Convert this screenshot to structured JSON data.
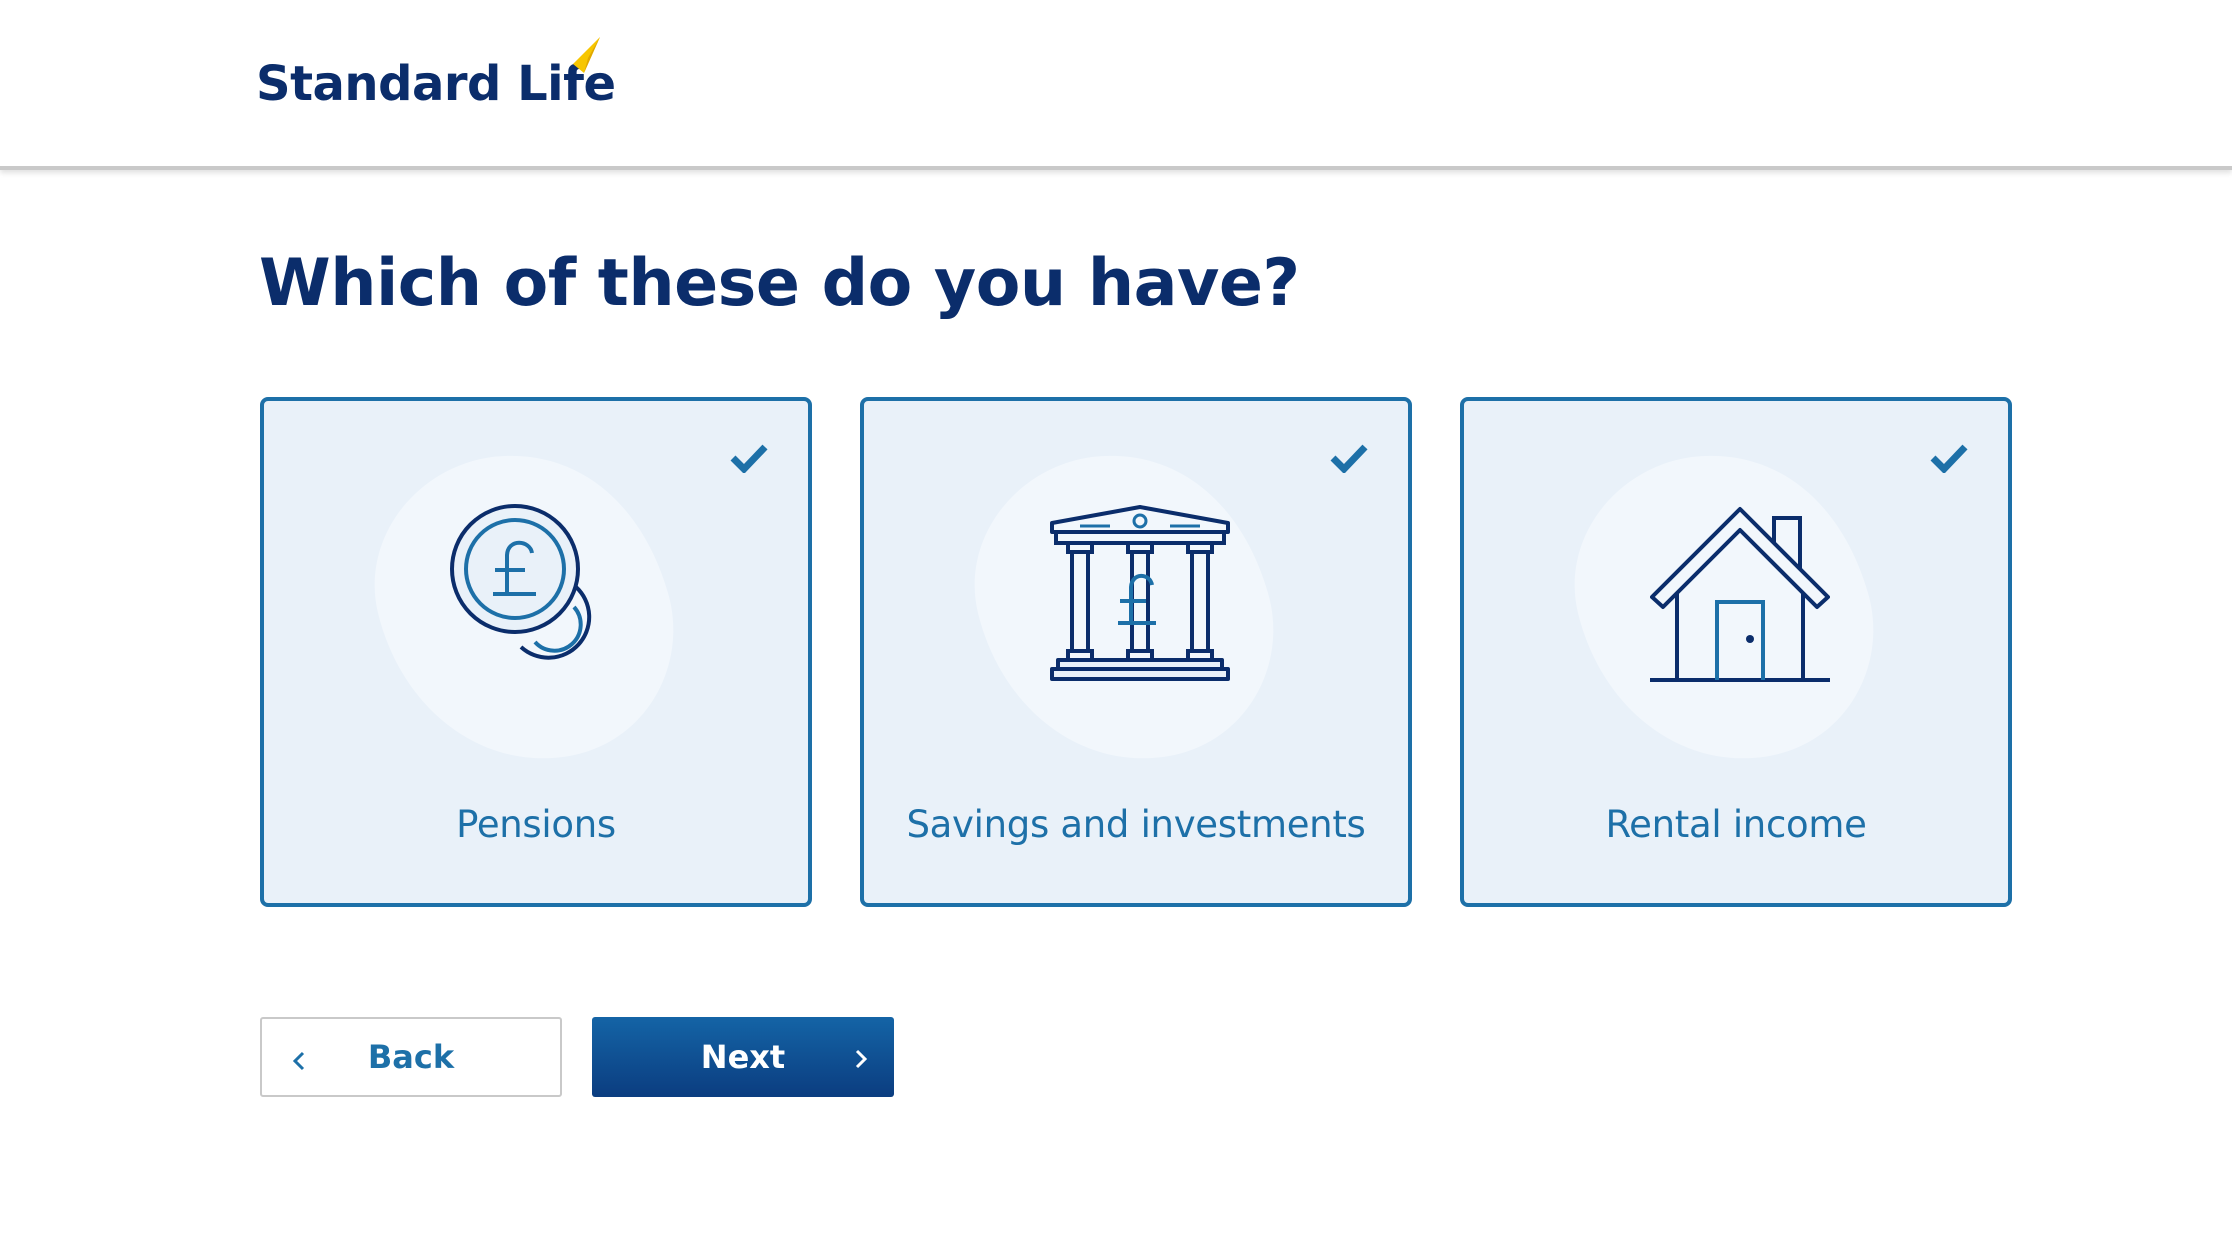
{
  "header": {
    "logo_text": "Standard Life"
  },
  "page": {
    "title": "Which of these do you have?"
  },
  "options": [
    {
      "label": "Pensions",
      "selected": true,
      "icon": "pound-coins-icon"
    },
    {
      "label": "Savings and investments",
      "selected": true,
      "icon": "bank-pound-icon"
    },
    {
      "label": "Rental income",
      "selected": true,
      "icon": "house-icon"
    }
  ],
  "nav": {
    "back_label": "Back",
    "next_label": "Next"
  },
  "colors": {
    "brand_navy": "#0b2d6b",
    "accent_blue": "#1d70a8",
    "card_background": "#e9f1f9",
    "logo_yellow": "#f7c600"
  }
}
